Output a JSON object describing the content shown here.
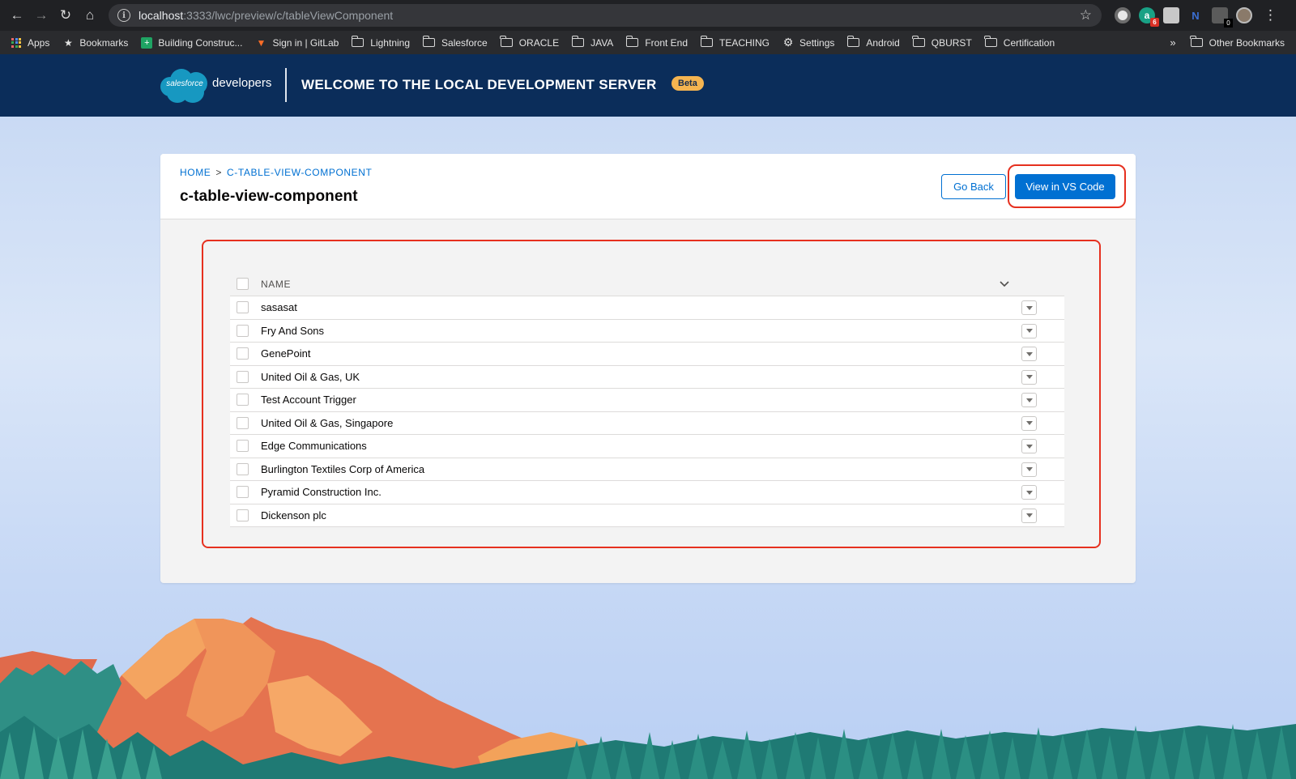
{
  "browser": {
    "url_host": "localhost",
    "url_rest": ":3333/lwc/preview/c/tableViewComponent",
    "extension_badges": {
      "grammarly": "6",
      "ext5": "0"
    },
    "bookmarks": [
      {
        "label": "Apps",
        "icon": "apps-grid-icon"
      },
      {
        "label": "Bookmarks",
        "icon": "star-icon"
      },
      {
        "label": "Building Construc...",
        "icon": "sheets-icon"
      },
      {
        "label": "Sign in | GitLab",
        "icon": "gitlab-icon"
      },
      {
        "label": "Lightning",
        "icon": "folder-icon"
      },
      {
        "label": "Salesforce",
        "icon": "folder-icon"
      },
      {
        "label": "ORACLE",
        "icon": "folder-icon"
      },
      {
        "label": "JAVA",
        "icon": "folder-icon"
      },
      {
        "label": "Front End",
        "icon": "folder-icon"
      },
      {
        "label": "TEACHING",
        "icon": "folder-icon"
      },
      {
        "label": "Settings",
        "icon": "gear-icon"
      },
      {
        "label": "Android",
        "icon": "folder-icon"
      },
      {
        "label": "QBURST",
        "icon": "folder-icon"
      },
      {
        "label": "Certification",
        "icon": "folder-icon"
      }
    ],
    "overflow_label": "»",
    "other_bookmarks": "Other Bookmarks"
  },
  "header": {
    "logo_text": "salesforce",
    "logo_suffix": "developers",
    "title": "WELCOME TO THE LOCAL DEVELOPMENT SERVER",
    "badge": "Beta"
  },
  "page": {
    "breadcrumb_home": "HOME",
    "breadcrumb_sep": ">",
    "breadcrumb_current": "C-TABLE-VIEW-COMPONENT",
    "title": "c-table-view-component",
    "go_back": "Go Back",
    "view_vscode": "View in VS Code"
  },
  "table": {
    "column": "NAME",
    "rows": [
      "sasasat",
      "Fry And Sons",
      "GenePoint",
      "United Oil & Gas, UK",
      "Test Account Trigger",
      "United Oil & Gas, Singapore",
      "Edge Communications",
      "Burlington Textiles Corp of America",
      "Pyramid Construction Inc.",
      "Dickenson plc"
    ]
  },
  "colors": {
    "brand_blue": "#0070d2",
    "header_navy": "#0b2d5a",
    "highlight_red": "#e6301f",
    "beta_orange": "#f5b450"
  }
}
